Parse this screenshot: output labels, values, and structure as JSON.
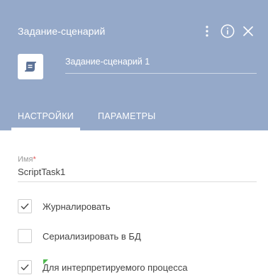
{
  "header": {
    "title": "Задание-сценарий",
    "element_name": "Задание-сценарий 1",
    "icons": [
      "kebab-menu-icon",
      "info-icon",
      "close-icon",
      "script-task-icon"
    ],
    "bg_color": "#95a9c9"
  },
  "tabs": [
    {
      "label": "НАСТРОЙКИ",
      "active": true
    },
    {
      "label": "ПАРАМЕТРЫ",
      "active": false
    }
  ],
  "fields": {
    "name": {
      "label": "Имя",
      "required_mark": "*",
      "value": "ScriptTask1"
    }
  },
  "checkboxes": [
    {
      "label": "Журналировать",
      "checked": true
    },
    {
      "label": "Сериализировать в БД",
      "checked": false
    },
    {
      "label": "Для интерпретируемого процесса",
      "checked": true
    }
  ]
}
